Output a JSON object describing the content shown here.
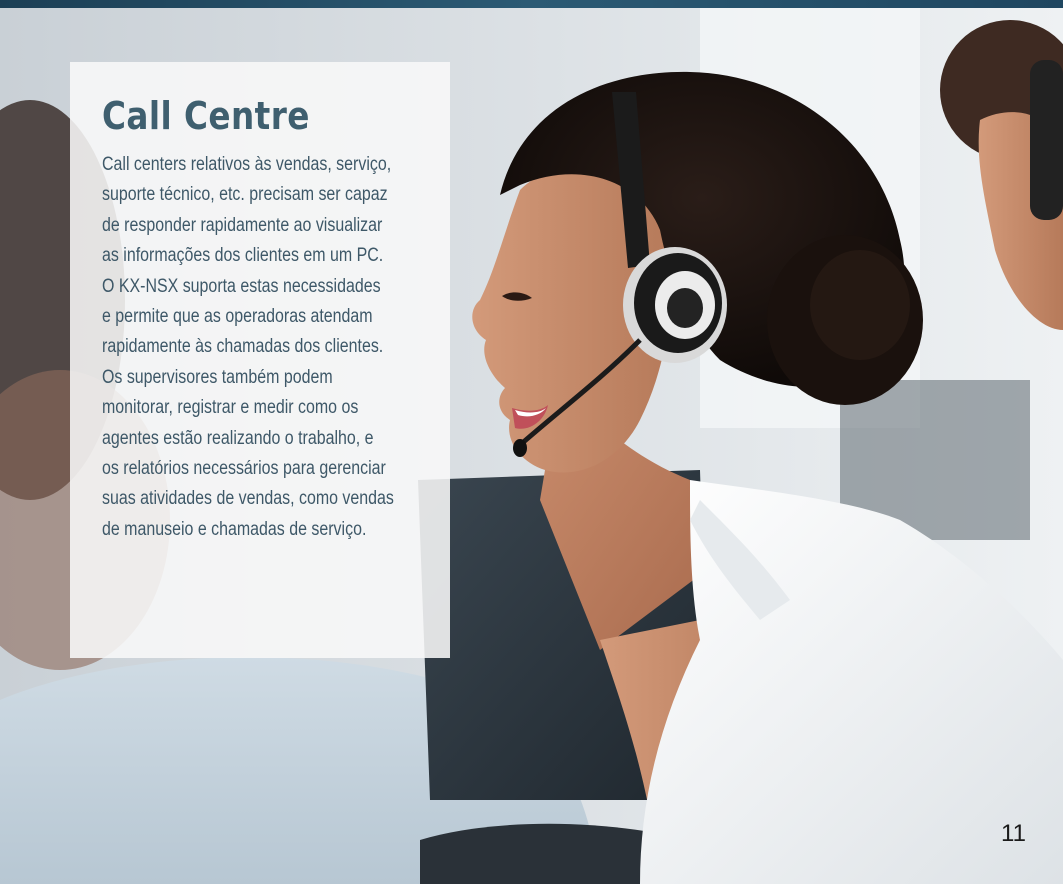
{
  "section": {
    "title": "Call Centre",
    "body_lines": [
      "Call centers relativos às vendas, serviço,",
      "suporte técnico, etc. precisam ser capaz",
      "de responder rapidamente ao visualizar",
      "as informações dos clientes em um PC.",
      "O KX-NSX suporta estas necessidades",
      "e permite que as operadoras atendam",
      "rapidamente às chamadas dos clientes.",
      "Os supervisores também podem",
      "monitorar, registrar e medir como os",
      "agentes estão realizando o trabalho, e",
      "os relatórios necessários para gerenciar",
      "suas atividades de vendas, como vendas",
      "de manuseio e chamadas de serviço."
    ]
  },
  "page_number": "11",
  "colors": {
    "title": "#3f5f6f",
    "body": "#3e5868",
    "card": "#f8f8f8",
    "top_strip": "#1c3f55"
  },
  "background_photo": {
    "icon": "call-centre-agent-photo"
  }
}
